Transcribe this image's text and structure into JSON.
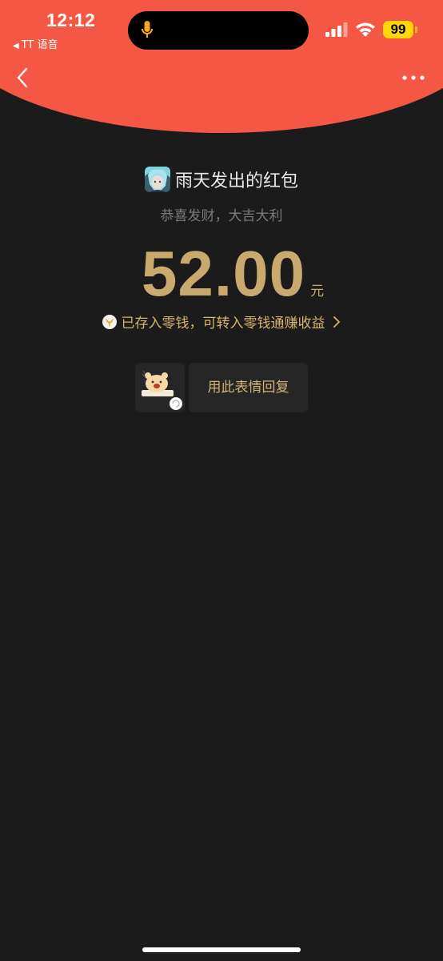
{
  "status_bar": {
    "time": "12:12",
    "back_app": "TT 语音",
    "battery": "99"
  },
  "red_packet": {
    "sender": "雨天发出的红包",
    "wish": "恭喜发财，大吉大利",
    "amount": "52.00",
    "currency": "元",
    "stored_note": "已存入零钱，可转入零钱通赚收益"
  },
  "reply": {
    "label": "用此表情回复"
  },
  "colors": {
    "header_red": "#f45744",
    "background": "#1b1b1b",
    "gold": "#c8a96e"
  }
}
